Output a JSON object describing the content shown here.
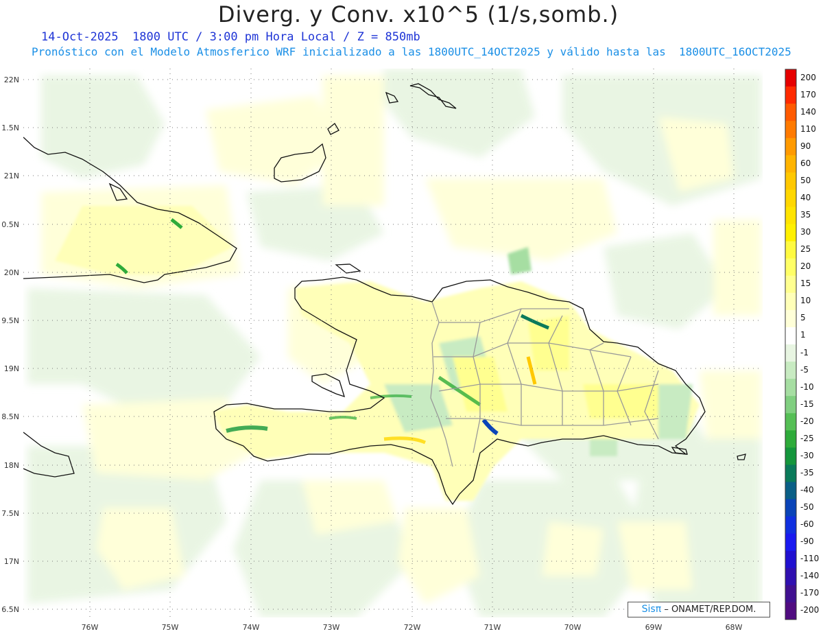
{
  "header": {
    "title": "Diverg. y Conv. x10^5 (1/s,somb.)",
    "subtitle_line1": "14-Oct-2025  1800 UTC / 3:00 pm Hora Local / Z = 850mb",
    "subtitle_line2": "Pronóstico con el Modelo Atmosferico WRF inicializado a las 1800UTC_14OCT2025 y válido hasta las  1800UTC_16OCT2025"
  },
  "axes": {
    "lat_labels": [
      "22N",
      "1.5N",
      "21N",
      "0.5N",
      "20N",
      "9.5N",
      "19N",
      "8.5N",
      "18N",
      "7.5N",
      "17N",
      "6.5N"
    ],
    "lon_labels": [
      "76W",
      "75W",
      "74W",
      "73W",
      "72W",
      "71W",
      "70W",
      "69W",
      "68W"
    ],
    "lat_range": [
      16.5,
      22.0
    ],
    "lon_range": [
      -76.65,
      -67.4
    ]
  },
  "colorbar": {
    "labels": [
      "200",
      "170",
      "140",
      "110",
      "90",
      "60",
      "50",
      "40",
      "35",
      "30",
      "25",
      "20",
      "15",
      "10",
      "5",
      "1",
      "-1",
      "-5",
      "-10",
      "-15",
      "-20",
      "-25",
      "-30",
      "-35",
      "-40",
      "-50",
      "-60",
      "-90",
      "-110",
      "-140",
      "-170",
      "-200"
    ],
    "colors": [
      "#e60000",
      "#ff2a00",
      "#ff5a00",
      "#ff7a00",
      "#ff9a00",
      "#ffb400",
      "#ffc800",
      "#ffd700",
      "#ffe400",
      "#fff000",
      "#fffa40",
      "#ffff66",
      "#ffff90",
      "#ffffb8",
      "#ffffd8",
      "#ffffff",
      "#e8f5e2",
      "#c8ebc2",
      "#a6dea2",
      "#80cf80",
      "#55bf55",
      "#2eab3a",
      "#14963c",
      "#0a7a5a",
      "#0a5f86",
      "#0a44b8",
      "#1030e0",
      "#1a1af0",
      "#2010d0",
      "#3010b0",
      "#401090",
      "#500c80"
    ]
  },
  "credit": {
    "sis": "Sis",
    "pi": "π",
    "org": "– ONAMET/REP.DOM."
  }
}
